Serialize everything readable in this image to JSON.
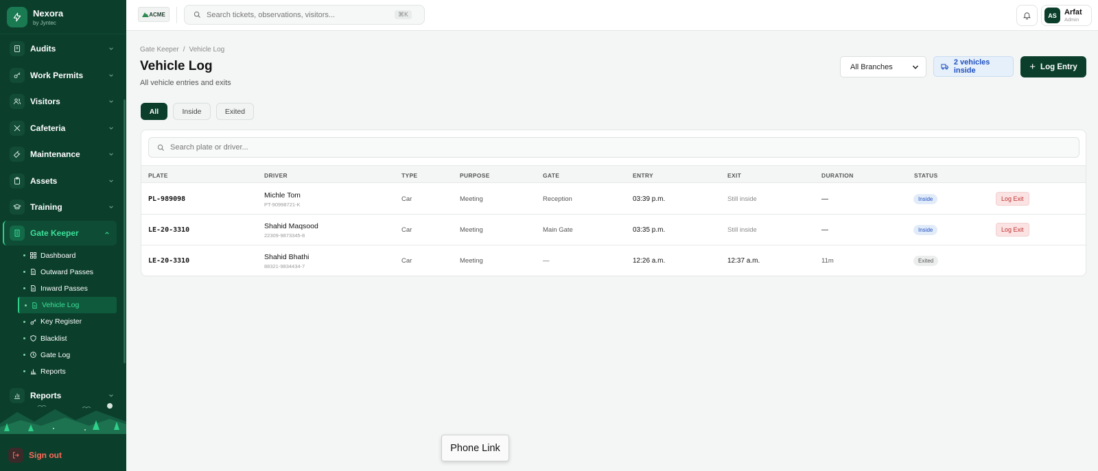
{
  "brand": {
    "name": "Nexora",
    "subtitle": "by Jyntec"
  },
  "nav": [
    {
      "label": "Audits",
      "icon": "audit-icon"
    },
    {
      "label": "Work Permits",
      "icon": "key-icon"
    },
    {
      "label": "Visitors",
      "icon": "users-icon"
    },
    {
      "label": "Cafeteria",
      "icon": "utensils-icon"
    },
    {
      "label": "Maintenance",
      "icon": "wrench-icon"
    },
    {
      "label": "Assets",
      "icon": "clipboard-icon"
    },
    {
      "label": "Training",
      "icon": "graduation-cap-icon"
    },
    {
      "label": "Gate Keeper",
      "icon": "building-icon"
    }
  ],
  "gatekeeper_sub": [
    {
      "label": "Dashboard",
      "icon": "grid-icon"
    },
    {
      "label": "Outward Passes",
      "icon": "document-icon"
    },
    {
      "label": "Inward Passes",
      "icon": "document-icon"
    },
    {
      "label": "Vehicle Log",
      "icon": "document-icon"
    },
    {
      "label": "Key Register",
      "icon": "key-icon"
    },
    {
      "label": "Blacklist",
      "icon": "shield-icon"
    },
    {
      "label": "Gate Log",
      "icon": "clock-icon"
    },
    {
      "label": "Reports",
      "icon": "bar-chart-icon"
    }
  ],
  "nav_reports": "Reports",
  "signout": "Sign out",
  "topbar": {
    "logo_text": "ACME",
    "search_placeholder": "Search tickets, observations, visitors...",
    "search_shortcut": "⌘K",
    "user_initials": "AS",
    "user_name": "Arfat",
    "user_role": "Admin"
  },
  "page": {
    "breadcrumb_root": "Gate Keeper",
    "breadcrumb_current": "Vehicle Log",
    "title": "Vehicle Log",
    "subtitle": "All vehicle entries and exits",
    "branch_select": "All Branches",
    "inside_badge": "2 vehicles inside",
    "log_entry_label": "Log Entry"
  },
  "filters": [
    "All",
    "Inside",
    "Exited"
  ],
  "table": {
    "search_placeholder": "Search plate or driver...",
    "columns": [
      "PLATE",
      "DRIVER",
      "TYPE",
      "PURPOSE",
      "GATE",
      "ENTRY",
      "EXIT",
      "DURATION",
      "STATUS"
    ],
    "rows": [
      {
        "plate": "PL-989098",
        "driver": "Michle Tom",
        "driver_id": "PT-90998721-K",
        "type": "Car",
        "purpose": "Meeting",
        "gate": "Reception",
        "entry": "03:39 p.m.",
        "exit": "Still inside",
        "duration": "—",
        "status": "Inside",
        "action": "Log Exit"
      },
      {
        "plate": "LE-20-3310",
        "driver": "Shahid Maqsood",
        "driver_id": "22309-9873345-8",
        "type": "Car",
        "purpose": "Meeting",
        "gate": "Main Gate",
        "entry": "03:35 p.m.",
        "exit": "Still inside",
        "duration": "—",
        "status": "Inside",
        "action": "Log Exit"
      },
      {
        "plate": "LE-20-3310",
        "driver": "Shahid Bhathi",
        "driver_id": "88321-9834434-7",
        "type": "Car",
        "purpose": "Meeting",
        "gate": "—",
        "entry": "12:26 a.m.",
        "exit": "12:37 a.m.",
        "duration": "11m",
        "status": "Exited",
        "action": ""
      }
    ]
  },
  "popup": "Phone Link",
  "colors": {
    "sidebar_bg": "#0b3f2c",
    "accent": "#2fd08a",
    "inside_blue": "#1f4fbf",
    "danger": "#c02e2e"
  }
}
